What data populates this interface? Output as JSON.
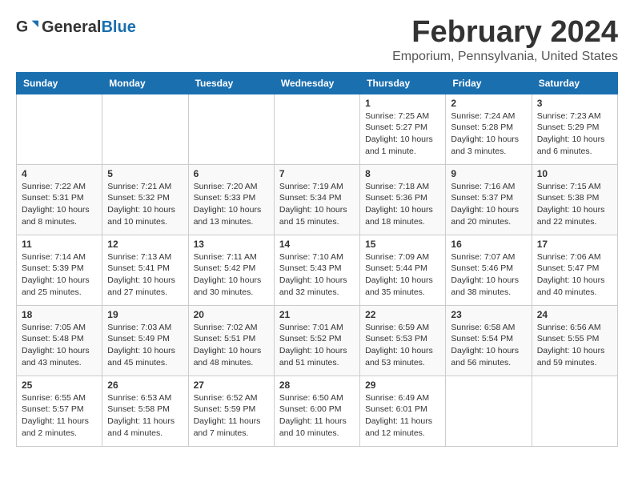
{
  "logo": {
    "text_general": "General",
    "text_blue": "Blue"
  },
  "title": "February 2024",
  "location": "Emporium, Pennsylvania, United States",
  "days_of_week": [
    "Sunday",
    "Monday",
    "Tuesday",
    "Wednesday",
    "Thursday",
    "Friday",
    "Saturday"
  ],
  "weeks": [
    [
      {
        "day": "",
        "info": ""
      },
      {
        "day": "",
        "info": ""
      },
      {
        "day": "",
        "info": ""
      },
      {
        "day": "",
        "info": ""
      },
      {
        "day": "1",
        "info": "Sunrise: 7:25 AM\nSunset: 5:27 PM\nDaylight: 10 hours\nand 1 minute."
      },
      {
        "day": "2",
        "info": "Sunrise: 7:24 AM\nSunset: 5:28 PM\nDaylight: 10 hours\nand 3 minutes."
      },
      {
        "day": "3",
        "info": "Sunrise: 7:23 AM\nSunset: 5:29 PM\nDaylight: 10 hours\nand 6 minutes."
      }
    ],
    [
      {
        "day": "4",
        "info": "Sunrise: 7:22 AM\nSunset: 5:31 PM\nDaylight: 10 hours\nand 8 minutes."
      },
      {
        "day": "5",
        "info": "Sunrise: 7:21 AM\nSunset: 5:32 PM\nDaylight: 10 hours\nand 10 minutes."
      },
      {
        "day": "6",
        "info": "Sunrise: 7:20 AM\nSunset: 5:33 PM\nDaylight: 10 hours\nand 13 minutes."
      },
      {
        "day": "7",
        "info": "Sunrise: 7:19 AM\nSunset: 5:34 PM\nDaylight: 10 hours\nand 15 minutes."
      },
      {
        "day": "8",
        "info": "Sunrise: 7:18 AM\nSunset: 5:36 PM\nDaylight: 10 hours\nand 18 minutes."
      },
      {
        "day": "9",
        "info": "Sunrise: 7:16 AM\nSunset: 5:37 PM\nDaylight: 10 hours\nand 20 minutes."
      },
      {
        "day": "10",
        "info": "Sunrise: 7:15 AM\nSunset: 5:38 PM\nDaylight: 10 hours\nand 22 minutes."
      }
    ],
    [
      {
        "day": "11",
        "info": "Sunrise: 7:14 AM\nSunset: 5:39 PM\nDaylight: 10 hours\nand 25 minutes."
      },
      {
        "day": "12",
        "info": "Sunrise: 7:13 AM\nSunset: 5:41 PM\nDaylight: 10 hours\nand 27 minutes."
      },
      {
        "day": "13",
        "info": "Sunrise: 7:11 AM\nSunset: 5:42 PM\nDaylight: 10 hours\nand 30 minutes."
      },
      {
        "day": "14",
        "info": "Sunrise: 7:10 AM\nSunset: 5:43 PM\nDaylight: 10 hours\nand 32 minutes."
      },
      {
        "day": "15",
        "info": "Sunrise: 7:09 AM\nSunset: 5:44 PM\nDaylight: 10 hours\nand 35 minutes."
      },
      {
        "day": "16",
        "info": "Sunrise: 7:07 AM\nSunset: 5:46 PM\nDaylight: 10 hours\nand 38 minutes."
      },
      {
        "day": "17",
        "info": "Sunrise: 7:06 AM\nSunset: 5:47 PM\nDaylight: 10 hours\nand 40 minutes."
      }
    ],
    [
      {
        "day": "18",
        "info": "Sunrise: 7:05 AM\nSunset: 5:48 PM\nDaylight: 10 hours\nand 43 minutes."
      },
      {
        "day": "19",
        "info": "Sunrise: 7:03 AM\nSunset: 5:49 PM\nDaylight: 10 hours\nand 45 minutes."
      },
      {
        "day": "20",
        "info": "Sunrise: 7:02 AM\nSunset: 5:51 PM\nDaylight: 10 hours\nand 48 minutes."
      },
      {
        "day": "21",
        "info": "Sunrise: 7:01 AM\nSunset: 5:52 PM\nDaylight: 10 hours\nand 51 minutes."
      },
      {
        "day": "22",
        "info": "Sunrise: 6:59 AM\nSunset: 5:53 PM\nDaylight: 10 hours\nand 53 minutes."
      },
      {
        "day": "23",
        "info": "Sunrise: 6:58 AM\nSunset: 5:54 PM\nDaylight: 10 hours\nand 56 minutes."
      },
      {
        "day": "24",
        "info": "Sunrise: 6:56 AM\nSunset: 5:55 PM\nDaylight: 10 hours\nand 59 minutes."
      }
    ],
    [
      {
        "day": "25",
        "info": "Sunrise: 6:55 AM\nSunset: 5:57 PM\nDaylight: 11 hours\nand 2 minutes."
      },
      {
        "day": "26",
        "info": "Sunrise: 6:53 AM\nSunset: 5:58 PM\nDaylight: 11 hours\nand 4 minutes."
      },
      {
        "day": "27",
        "info": "Sunrise: 6:52 AM\nSunset: 5:59 PM\nDaylight: 11 hours\nand 7 minutes."
      },
      {
        "day": "28",
        "info": "Sunrise: 6:50 AM\nSunset: 6:00 PM\nDaylight: 11 hours\nand 10 minutes."
      },
      {
        "day": "29",
        "info": "Sunrise: 6:49 AM\nSunset: 6:01 PM\nDaylight: 11 hours\nand 12 minutes."
      },
      {
        "day": "",
        "info": ""
      },
      {
        "day": "",
        "info": ""
      }
    ]
  ]
}
